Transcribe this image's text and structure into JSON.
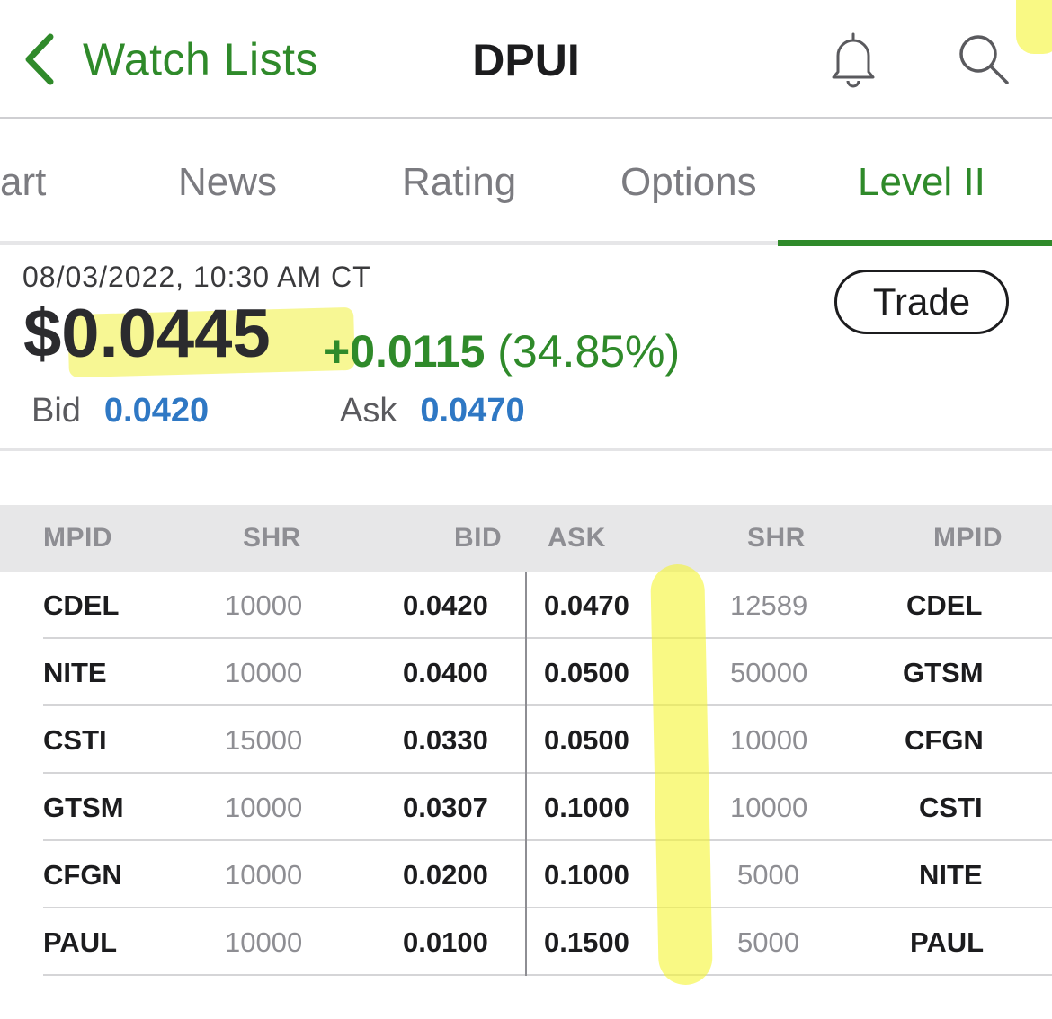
{
  "header": {
    "back_label": "Watch Lists",
    "title": "DPUI",
    "icons": [
      "chevron-left-icon",
      "bell-icon",
      "search-icon"
    ]
  },
  "tabs": [
    {
      "label": "art",
      "active": false
    },
    {
      "label": "News",
      "active": false
    },
    {
      "label": "Rating",
      "active": false
    },
    {
      "label": "Options",
      "active": false
    },
    {
      "label": "Level II",
      "active": true
    }
  ],
  "quote": {
    "timestamp": "08/03/2022, 10:30 AM CT",
    "price": "$0.0445",
    "change": "+0.0115",
    "change_pct": "(34.85%)",
    "bid_label": "Bid",
    "bid": "0.0420",
    "ask_label": "Ask",
    "ask": "0.0470",
    "trade_label": "Trade"
  },
  "level2": {
    "columns": [
      "MPID",
      "SHR",
      "BID",
      "ASK",
      "SHR",
      "MPID"
    ],
    "rows": [
      {
        "bid_mpid": "CDEL",
        "bid_shr": "10000",
        "bid": "0.0420",
        "ask": "0.0470",
        "ask_shr": "12589",
        "ask_mpid": "CDEL"
      },
      {
        "bid_mpid": "NITE",
        "bid_shr": "10000",
        "bid": "0.0400",
        "ask": "0.0500",
        "ask_shr": "50000",
        "ask_mpid": "GTSM"
      },
      {
        "bid_mpid": "CSTI",
        "bid_shr": "15000",
        "bid": "0.0330",
        "ask": "0.0500",
        "ask_shr": "10000",
        "ask_mpid": "CFGN"
      },
      {
        "bid_mpid": "GTSM",
        "bid_shr": "10000",
        "bid": "0.0307",
        "ask": "0.1000",
        "ask_shr": "10000",
        "ask_mpid": "CSTI"
      },
      {
        "bid_mpid": "CFGN",
        "bid_shr": "10000",
        "bid": "0.0200",
        "ask": "0.1000",
        "ask_shr": "5000",
        "ask_mpid": "NITE"
      },
      {
        "bid_mpid": "PAUL",
        "bid_shr": "10000",
        "bid": "0.0100",
        "ask": "0.1500",
        "ask_shr": "5000",
        "ask_mpid": "PAUL"
      }
    ]
  },
  "colors": {
    "accent_green": "#2f8a2a",
    "quote_blue": "#2f78c4",
    "highlighter_yellow": "#f5f532"
  }
}
